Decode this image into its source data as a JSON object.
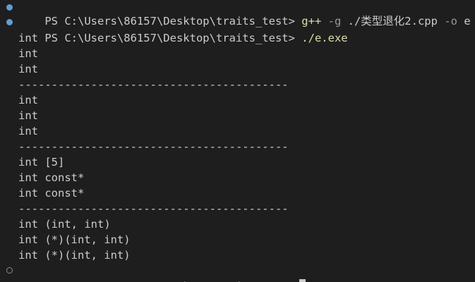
{
  "terminal": {
    "prompt": "PS C:\\Users\\86157\\Desktop\\traits_test>",
    "command1": {
      "program": "g++",
      "flag1": "-g",
      "file": "./类型退化2.cpp",
      "flag2": "-o",
      "output": "e"
    },
    "command2": "./e.exe",
    "output": [
      "int",
      "int",
      "int",
      "-----------------------------------------",
      "int",
      "int",
      "int",
      "-----------------------------------------",
      "int [5]",
      "int const*",
      "int const*",
      "-----------------------------------------",
      "int (int, int)",
      "int (*)(int, int)",
      "int (*)(int, int)"
    ]
  },
  "colors": {
    "background": "#1e1e1e",
    "text": "#cccccc",
    "command": "#dcdcaa",
    "flag": "#9a9a9a",
    "dot_success": "#5f9ed6",
    "dot_idle": "#8a8a8a"
  },
  "icons": {
    "decoration_success": "filled-circle",
    "decoration_idle": "hollow-circle"
  }
}
